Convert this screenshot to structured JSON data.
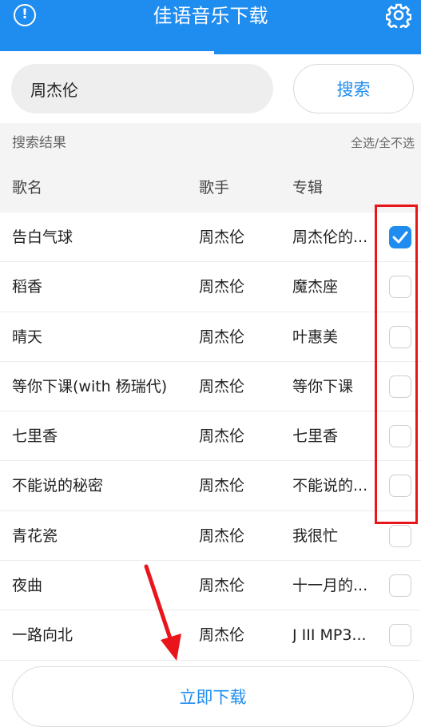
{
  "header": {
    "title": "佳语音乐下载",
    "info_icon": "info-icon",
    "info_glyph": "!",
    "settings_icon": "gear-icon"
  },
  "search": {
    "value": "周杰伦",
    "button_label": "搜索"
  },
  "results": {
    "label": "搜索结果",
    "select_all_label": "全选/全不选"
  },
  "columns": {
    "name": "歌名",
    "singer": "歌手",
    "album": "专辑"
  },
  "songs": [
    {
      "name": "告白气球",
      "singer": "周杰伦",
      "album": "周杰伦的...",
      "checked": true
    },
    {
      "name": "稻香",
      "singer": "周杰伦",
      "album": "魔杰座",
      "checked": false
    },
    {
      "name": "晴天",
      "singer": "周杰伦",
      "album": "叶惠美",
      "checked": false
    },
    {
      "name": "等你下课(with 杨瑞代)",
      "singer": "周杰伦",
      "album": "等你下课",
      "checked": false
    },
    {
      "name": "七里香",
      "singer": "周杰伦",
      "album": "七里香",
      "checked": false
    },
    {
      "name": "不能说的秘密",
      "singer": "周杰伦",
      "album": "不能说的...",
      "checked": false
    },
    {
      "name": "青花瓷",
      "singer": "周杰伦",
      "album": "我很忙",
      "checked": false
    },
    {
      "name": "夜曲",
      "singer": "周杰伦",
      "album": "十一月的...",
      "checked": false
    },
    {
      "name": "一路向北",
      "singer": "周杰伦",
      "album": "J III MP3...",
      "checked": false
    }
  ],
  "download_button_label": "立即下载",
  "colors": {
    "accent": "#1f8cf0",
    "annotation": "#e8151b"
  }
}
